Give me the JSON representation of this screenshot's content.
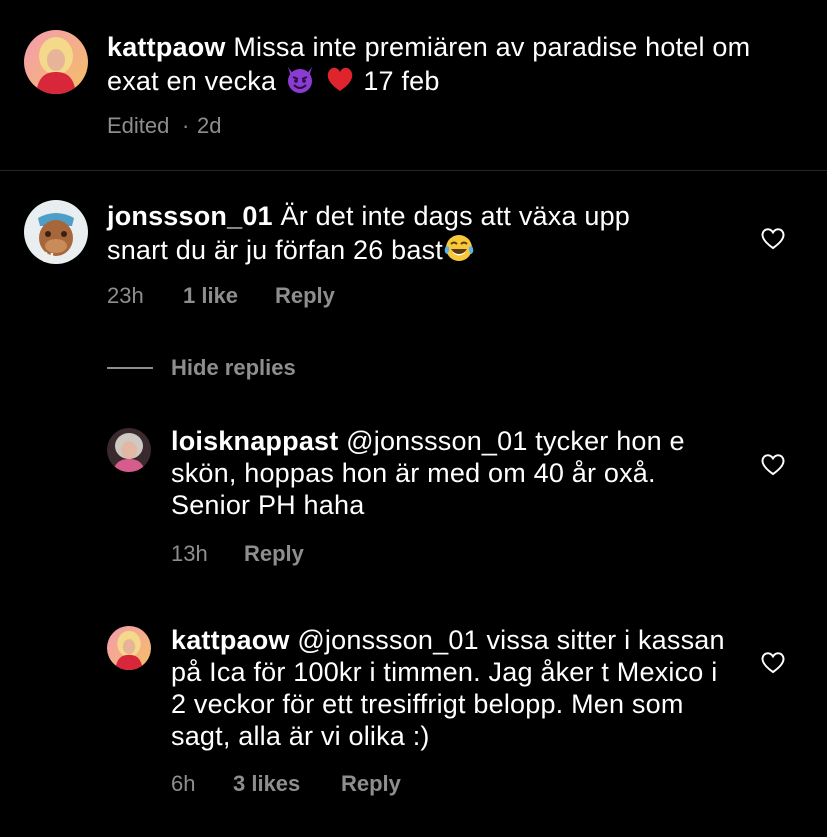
{
  "caption": {
    "username": "kattpaow",
    "text_before_emoji": "Missa inte premiären av paradise hotel om exat en vecka",
    "emoji_1": "devil-emoji",
    "emoji_2": "red-heart-emoji",
    "text_after_emoji": "17 feb",
    "edited": "Edited",
    "separator": "·",
    "time": "2d"
  },
  "comments": [
    {
      "username": "jonssson_01",
      "text": "Är det inte dags att växa upp snart du är ju förfan 26 bast",
      "emoji": "tears-of-joy-emoji",
      "time": "23h",
      "likes": "1 like",
      "reply": "Reply"
    }
  ],
  "hide_replies": "Hide replies",
  "replies": [
    {
      "username": "loisknappast",
      "text": "@jonssson_01 tycker hon e skön, hoppas hon är med om 40 år oxå. Senior PH haha",
      "time": "13h",
      "reply": "Reply"
    },
    {
      "username": "kattpaow",
      "text": "@jonssson_01 vissa sitter i kassan på Ica för 100kr i timmen. Jag åker t Mexico i 2 veckor för ett tresiffrigt belopp. Men som sagt, alla är vi olika :)",
      "time": "6h",
      "likes": "3 likes",
      "reply": "Reply"
    }
  ],
  "icons": {
    "like": "heart-outline-icon"
  },
  "colors": {
    "background": "#000000",
    "text": "#ffffff",
    "secondary": "#8e8e8e",
    "divider": "#262626"
  }
}
